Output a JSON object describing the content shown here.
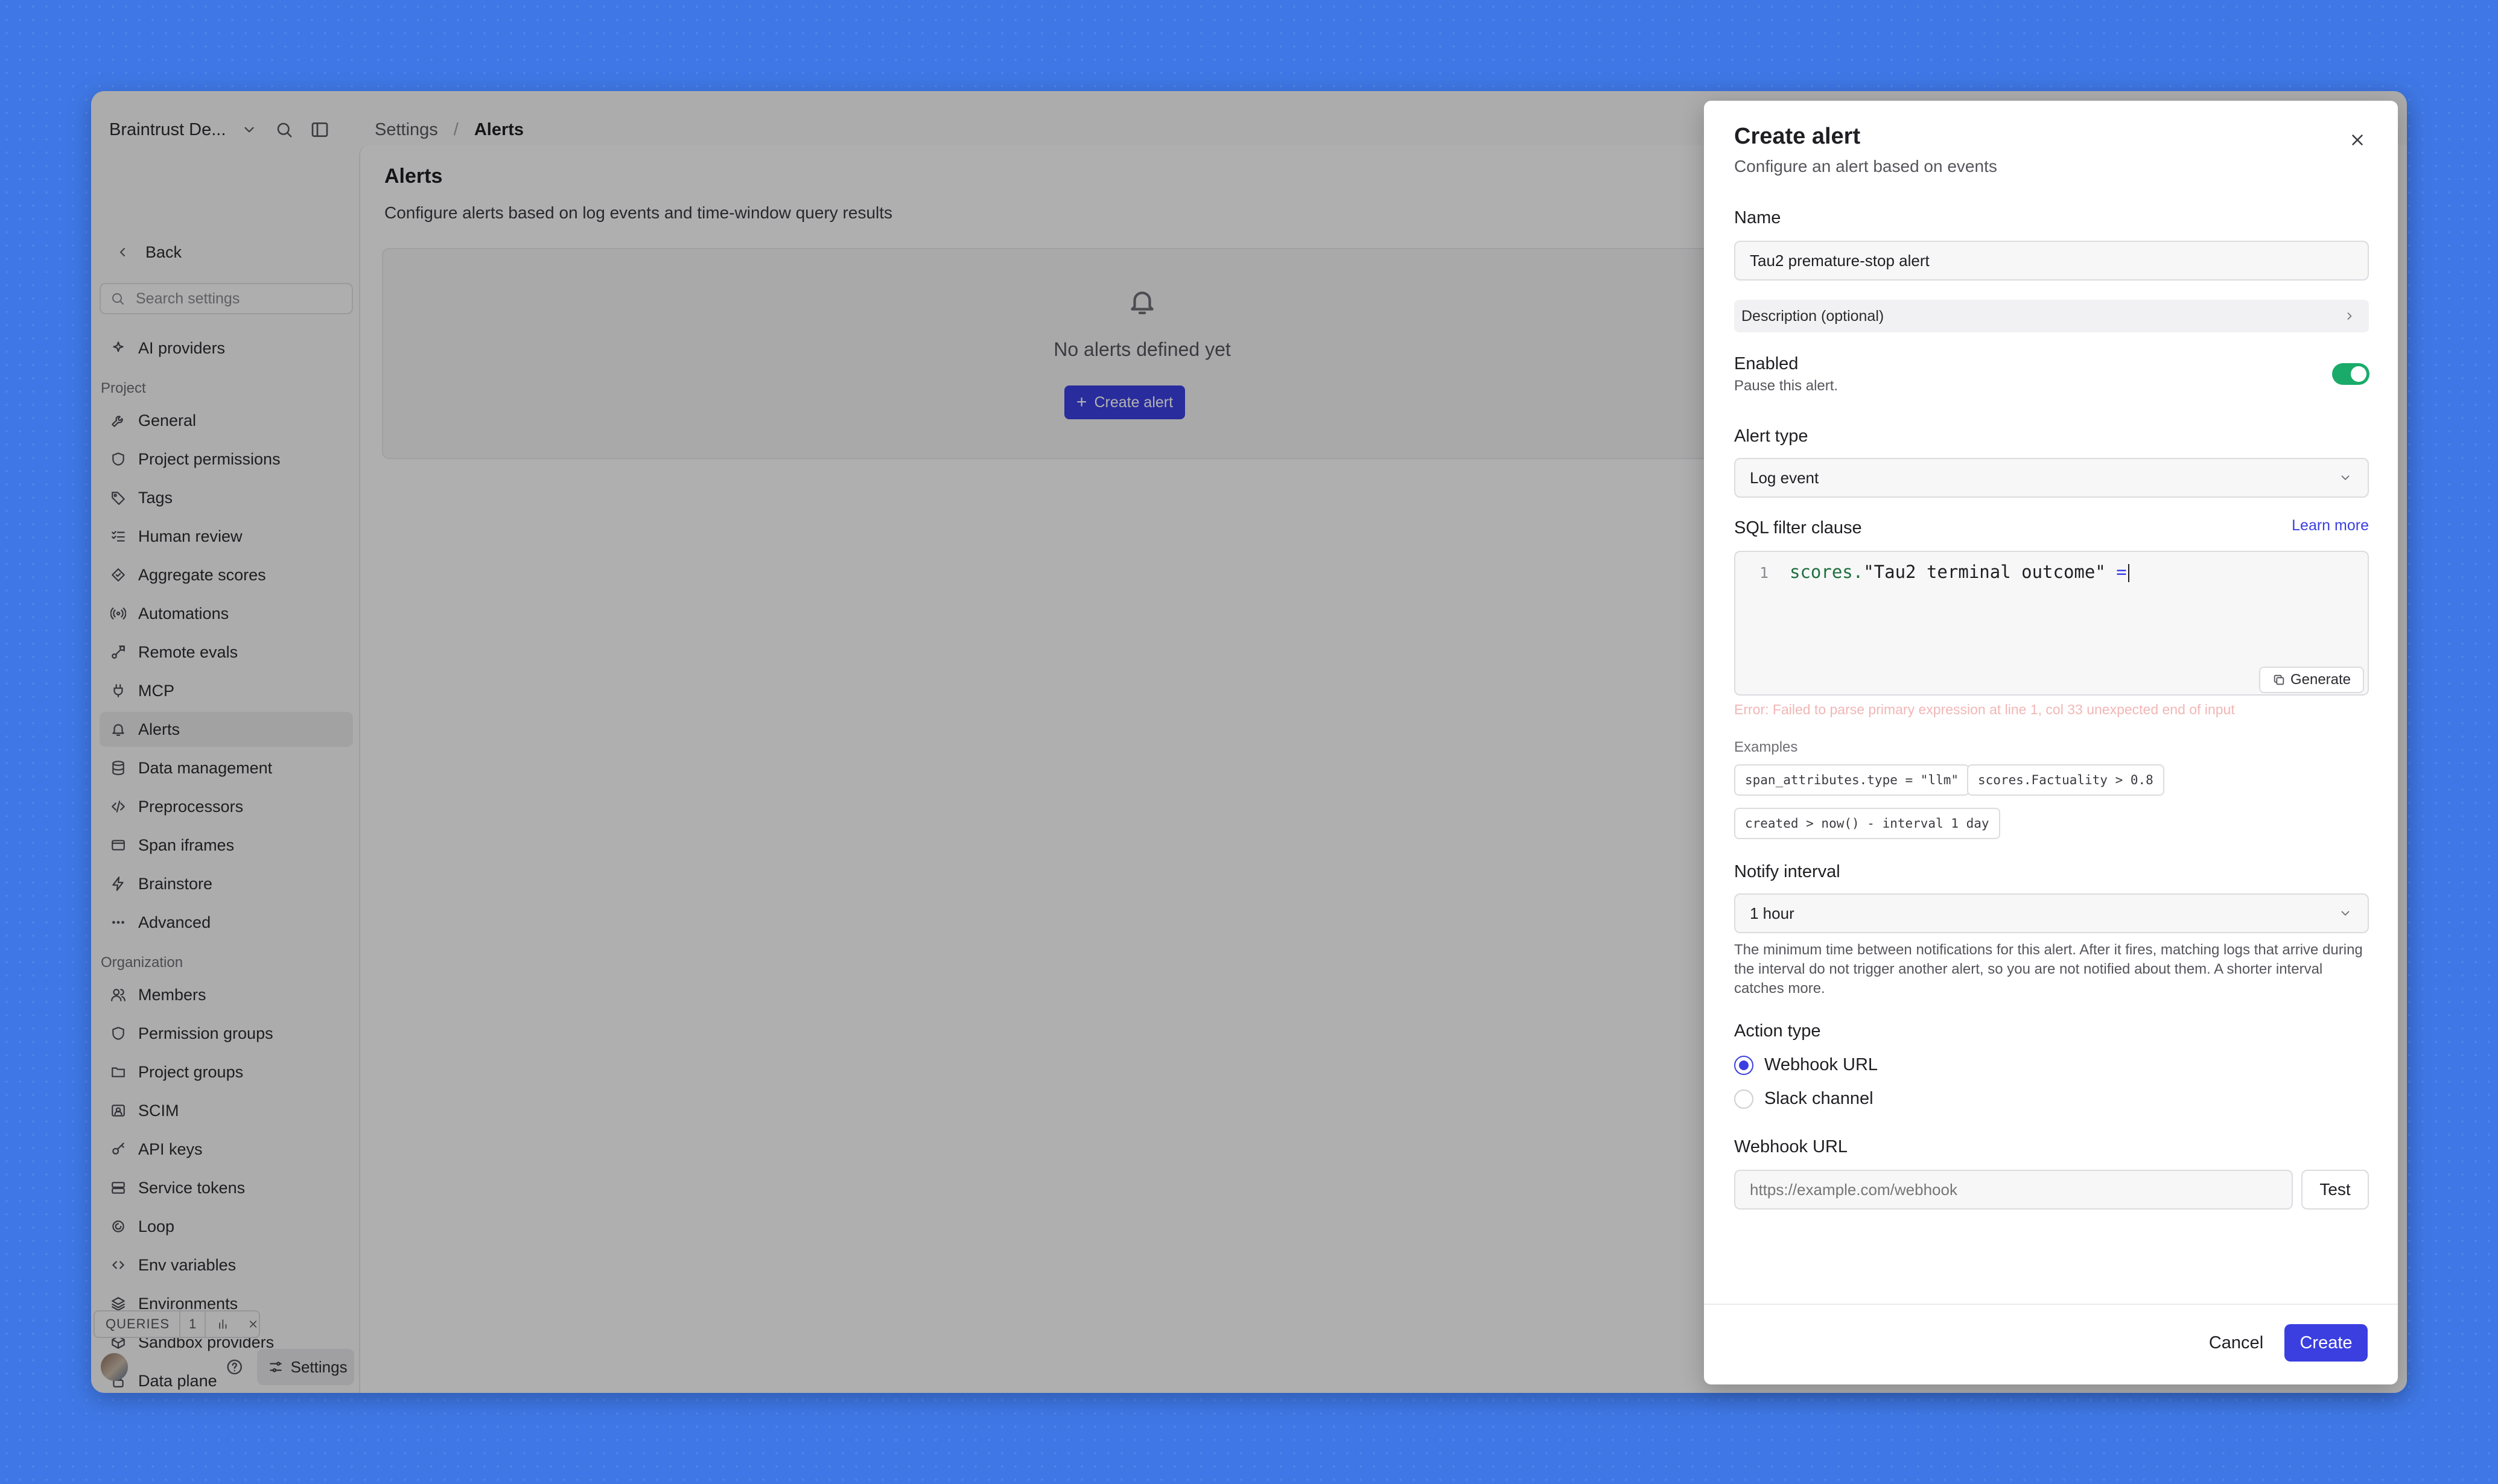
{
  "sidebar": {
    "team_name": "Braintrust De...",
    "back_label": "Back",
    "search_placeholder": "Search settings",
    "top_item": "AI providers",
    "project_label": "Project",
    "project_items": [
      "General",
      "Project permissions",
      "Tags",
      "Human review",
      "Aggregate scores",
      "Automations",
      "Remote evals",
      "MCP",
      "Alerts",
      "Data management",
      "Preprocessors",
      "Span iframes",
      "Brainstore",
      "Advanced"
    ],
    "active_item": "Alerts",
    "organization_label": "Organization",
    "organization_items": [
      "Members",
      "Permission groups",
      "Project groups",
      "SCIM",
      "API keys",
      "Service tokens",
      "Loop",
      "Env variables",
      "Environments",
      "Sandbox providers",
      "Data plane"
    ],
    "queries_label": "QUERIES",
    "queries_count": "1",
    "settings_label": "Settings"
  },
  "breadcrumb": {
    "parent": "Settings",
    "separator": "/",
    "current": "Alerts"
  },
  "main": {
    "title": "Alerts",
    "description": "Configure alerts based on log events and time-window query results",
    "empty_text": "No alerts defined yet",
    "create_button": "Create alert"
  },
  "modal": {
    "title": "Create alert",
    "subtitle": "Configure an alert based on events",
    "name_label": "Name",
    "name_value": "Tau2 premature-stop alert",
    "description_label": "Description (optional)",
    "enabled_label": "Enabled",
    "enabled_hint": "Pause this alert.",
    "enabled": true,
    "alert_type_label": "Alert type",
    "alert_type_value": "Log event",
    "sql_label": "SQL filter clause",
    "learn_more": "Learn more",
    "code_line_number": "1",
    "code_tokens": {
      "field": "scores.",
      "string": "\"Tau2 terminal outcome\"",
      "operator": " ="
    },
    "generate_label": "Generate",
    "error_text": "Error: Failed to parse primary expression at line 1, col 33 unexpected end of input",
    "examples_label": "Examples",
    "examples": [
      "span_attributes.type = \"llm\"",
      "scores.Factuality > 0.8",
      "created > now() - interval 1 day"
    ],
    "notify_label": "Notify interval",
    "notify_value": "1 hour",
    "notify_hint": "The minimum time between notifications for this alert. After it fires, matching logs that arrive during the interval do not trigger another alert, so you are not notified about them. A shorter interval catches more.",
    "action_label": "Action type",
    "action_options": [
      "Webhook URL",
      "Slack channel"
    ],
    "action_selected": "Webhook URL",
    "webhook_label": "Webhook URL",
    "webhook_placeholder": "https://example.com/webhook",
    "test_label": "Test",
    "cancel_label": "Cancel",
    "create_label": "Create"
  },
  "colors": {
    "accent": "#3b3fe0",
    "toggle_on": "#1aab6a",
    "background": "#3f78e6"
  },
  "icons": {
    "top_item": "sparkle-icon",
    "project_items": [
      "wrench-icon",
      "shield-icon",
      "tag-icon",
      "list-check-icon",
      "diamond-icon",
      "broadcast-icon",
      "remote-icon",
      "plug-icon",
      "bell-icon",
      "database-icon",
      "code-icon",
      "frame-icon",
      "bolt-icon",
      "ellipsis-icon"
    ],
    "organization_items": [
      "users-icon",
      "shield-icon",
      "folder-icon",
      "id-card-icon",
      "key-icon",
      "server-icon",
      "loop-icon",
      "code-icon",
      "layers-icon",
      "box-icon",
      "lock-icon"
    ]
  }
}
